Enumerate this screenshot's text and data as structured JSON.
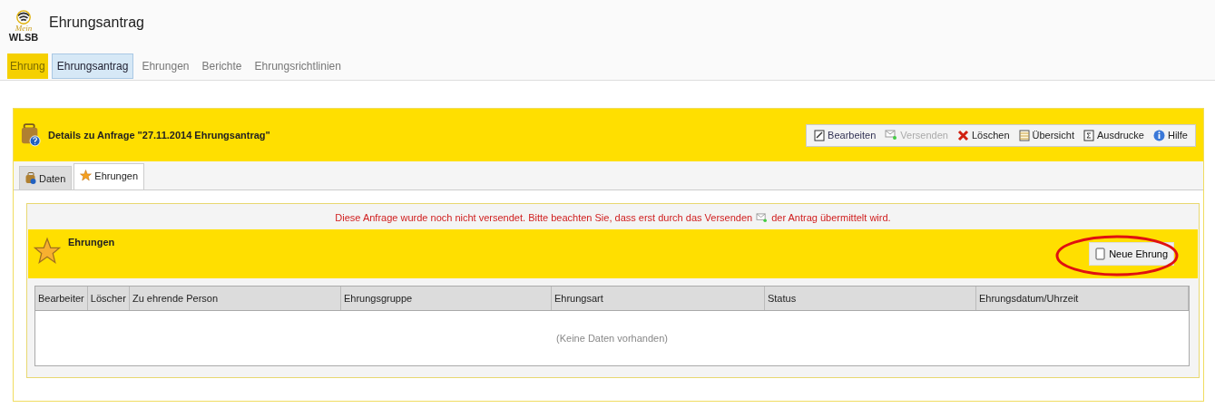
{
  "app": {
    "logo_script": "Mein",
    "logo_text": "WLSB",
    "title": "Ehrungsantrag"
  },
  "nav": {
    "module": "Ehrung",
    "tabs": [
      {
        "label": "Ehrungsantrag",
        "selected": true
      },
      {
        "label": "Ehrungen",
        "selected": false
      },
      {
        "label": "Berichte",
        "selected": false
      },
      {
        "label": "Ehrungsrichtlinien",
        "selected": false
      }
    ]
  },
  "panel": {
    "title": "Details zu  Anfrage \"27.11.2014 Ehrungsantrag\"",
    "toolbar": [
      {
        "kind": "edit",
        "label": "Bearbeiten",
        "disabled": false
      },
      {
        "kind": "send",
        "label": "Versenden",
        "disabled": true
      },
      {
        "kind": "delete",
        "label": "Löschen",
        "disabled": false
      },
      {
        "kind": "overview",
        "label": "Übersicht",
        "disabled": false
      },
      {
        "kind": "print",
        "label": "Ausdrucke",
        "disabled": false
      },
      {
        "kind": "help",
        "label": "Hilfe",
        "disabled": false
      }
    ],
    "tabs": [
      {
        "kind": "data",
        "label": "Daten",
        "selected": false
      },
      {
        "kind": "star",
        "label": "Ehrungen",
        "selected": true
      }
    ]
  },
  "notice": {
    "before": "Diese Anfrage wurde noch nicht versendet. Bitte beachten Sie, dass erst durch das Versenden",
    "after": "der Antrag übermittelt wird."
  },
  "section": {
    "title": "Ehrungen",
    "button": {
      "label": "Neue Ehrung",
      "circled": true
    }
  },
  "table": {
    "columns": [
      "Bearbeiter",
      "Löscher",
      "Zu ehrende Person",
      "Ehrungsgruppe",
      "Ehrungsart",
      "Status",
      "Ehrungsdatum/Uhrzeit"
    ],
    "empty_text": "(Keine Daten vorhanden)"
  }
}
